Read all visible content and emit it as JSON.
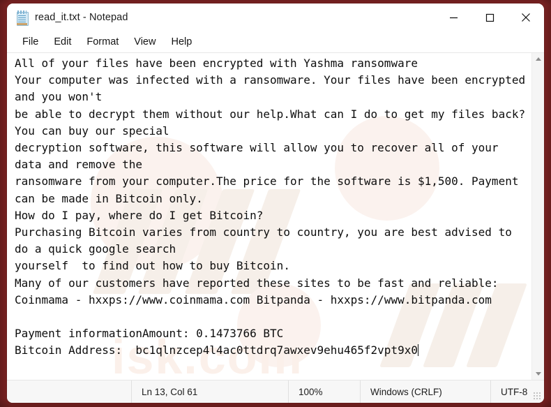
{
  "window": {
    "title": "read_it.txt - Notepad",
    "icon": "notepad-icon",
    "border_color": "#7d2323",
    "controls": {
      "minimize": "Minimize",
      "maximize": "Maximize",
      "close": "Close"
    }
  },
  "menubar": {
    "items": [
      {
        "label": "File"
      },
      {
        "label": "Edit"
      },
      {
        "label": "Format"
      },
      {
        "label": "View"
      },
      {
        "label": "Help"
      }
    ]
  },
  "editor": {
    "content": "All of your files have been encrypted with Yashma ransomware\nYour computer was infected with a ransomware. Your files have been encrypted and you won't\nbe able to decrypt them without our help.What can I do to get my files back?You can buy our special\ndecryption software, this software will allow you to recover all of your data and remove the\nransomware from your computer.The price for the software is $1,500. Payment can be made in Bitcoin only.\nHow do I pay, where do I get Bitcoin?\nPurchasing Bitcoin varies from country to country, you are best advised to do a quick google search\nyourself  to find out how to buy Bitcoin.\nMany of our customers have reported these sites to be fast and reliable:\nCoinmama - hxxps://www.coinmama.com Bitpanda - hxxps://www.bitpanda.com\n\nPayment informationAmount: 0.1473766 BTC\nBitcoin Address:  bc1qlnzcep4l4ac0ttdrq7awxev9ehu465f2vpt9x0",
    "placeholder": ""
  },
  "scrollbar": {
    "up_arrow": "scroll-up",
    "down_arrow": "scroll-down"
  },
  "statusbar": {
    "line_col": "Ln 13, Col 61",
    "zoom": "100%",
    "line_endings": "Windows (CRLF)",
    "encoding": "UTF-8"
  }
}
